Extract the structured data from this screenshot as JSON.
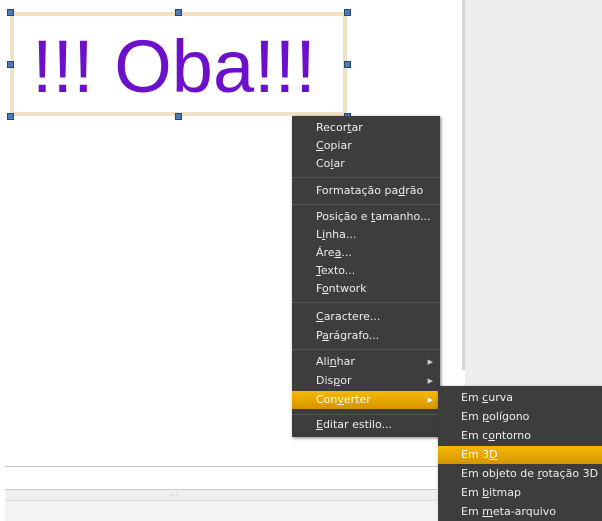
{
  "canvas": {
    "text_object": {
      "text": "!!! Oba!!!",
      "color": "#6c10cc"
    }
  },
  "context_menu": {
    "items": [
      {
        "pre": "Recor",
        "acc": "t",
        "post": "ar"
      },
      {
        "pre": "",
        "acc": "C",
        "post": "opiar"
      },
      {
        "pre": "Co",
        "acc": "l",
        "post": "ar"
      },
      {
        "pre": "Formatação pa",
        "acc": "d",
        "post": "rão"
      },
      {
        "pre": "Posição e ",
        "acc": "t",
        "post": "amanho..."
      },
      {
        "pre": "L",
        "acc": "i",
        "post": "nha..."
      },
      {
        "pre": "Áre",
        "acc": "a",
        "post": "..."
      },
      {
        "pre": "",
        "acc": "T",
        "post": "exto..."
      },
      {
        "pre": "F",
        "acc": "o",
        "post": "ntwork"
      },
      {
        "pre": "",
        "acc": "C",
        "post": "aractere..."
      },
      {
        "pre": "P",
        "acc": "a",
        "post": "rágrafo..."
      },
      {
        "pre": "Ali",
        "acc": "n",
        "post": "har"
      },
      {
        "pre": "Dis",
        "acc": "p",
        "post": "or"
      },
      {
        "pre": "Con",
        "acc": "v",
        "post": "erter"
      },
      {
        "pre": "",
        "acc": "E",
        "post": "ditar estilo..."
      }
    ]
  },
  "submenu": {
    "items": [
      {
        "pre": "Em ",
        "acc": "c",
        "post": "urva"
      },
      {
        "pre": "Em ",
        "acc": "p",
        "post": "olígono"
      },
      {
        "pre": "Em c",
        "acc": "o",
        "post": "ntorno"
      },
      {
        "pre": "Em 3",
        "acc": "D",
        "post": ""
      },
      {
        "pre": "Em objeto de ",
        "acc": "r",
        "post": "otação 3D"
      },
      {
        "pre": "Em ",
        "acc": "b",
        "post": "itmap"
      },
      {
        "pre": "Em ",
        "acc": "m",
        "post": "eta-arquivo"
      }
    ]
  },
  "colors": {
    "menu_bg": "#3d3d3d",
    "highlight": "#e8a800",
    "text_color": "#6c10cc"
  },
  "icons": {
    "submenu_arrow": "triangle-right-icon"
  }
}
